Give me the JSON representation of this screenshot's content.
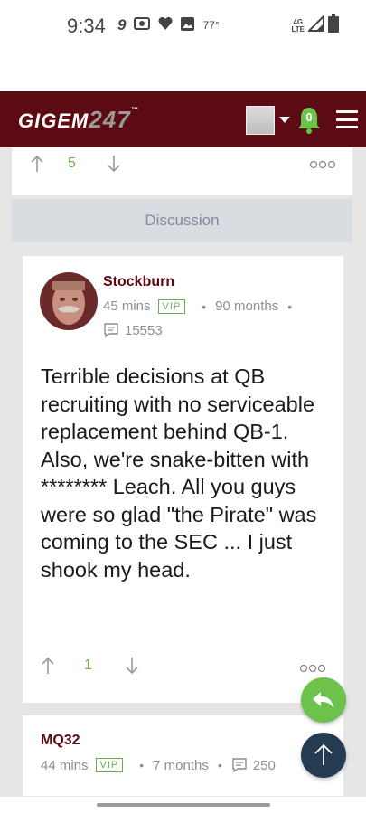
{
  "status": {
    "time": "9:34",
    "temperature": "77°",
    "network": "4G",
    "network_sub": "LTE"
  },
  "header": {
    "logo_text": "GIGEM",
    "logo_num": "247",
    "logo_tm": "™",
    "notification_count": "0"
  },
  "top_card": {
    "vote_count": "5"
  },
  "discussion": {
    "label": "Discussion"
  },
  "post1": {
    "username": "Stockburn",
    "time": "45 mins",
    "badge": "VIP",
    "tenure": "90 months",
    "post_count": "15553",
    "body": "Terrible decisions at QB recruiting with no serviceable replacement behind QB-1. Also, we're snake-bitten with ******** Leach. All you guys were so glad \"the Pirate\" was coming to the SEC ... I just shook my head.",
    "vote_count": "1"
  },
  "post2": {
    "username": "MQ32",
    "time": "44 mins",
    "badge": "VIP",
    "tenure": "7 months",
    "post_count": "250"
  },
  "colors": {
    "brand": "#5c0b14",
    "accent_green": "#6ab04c",
    "fab_blue": "#243b52"
  },
  "icons": [
    "wifi-calling-icon",
    "camera-icon",
    "heart-icon",
    "image-icon",
    "signal-icon",
    "battery-icon",
    "bell-icon",
    "menu-icon",
    "upvote-icon",
    "downvote-icon",
    "more-icon",
    "comment-icon",
    "reply-icon",
    "arrow-up-icon"
  ]
}
